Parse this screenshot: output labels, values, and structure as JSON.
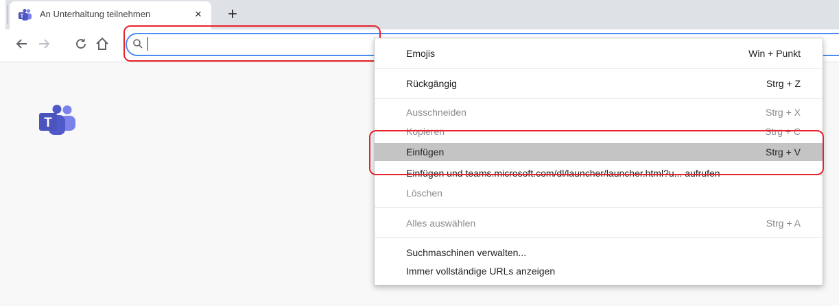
{
  "tab": {
    "title": "An Unterhaltung teilnehmen",
    "close": "×",
    "new_tab": "+"
  },
  "icons": {
    "tab_favicon": "teams-icon",
    "back": "back-arrow-icon",
    "forward": "forward-arrow-icon",
    "reload": "reload-icon",
    "home": "home-icon",
    "search": "search-icon",
    "page_logo": "teams-logo-icon"
  },
  "omnibox": {
    "value": "",
    "placeholder": ""
  },
  "context_menu": {
    "items": [
      {
        "label": "Emojis",
        "shortcut": "Win + Punkt",
        "state": "enabled"
      },
      {
        "label": "Rückgängig",
        "shortcut": "Strg + Z",
        "state": "enabled"
      },
      {
        "label": "Ausschneiden",
        "shortcut": "Strg + X",
        "state": "disabled"
      },
      {
        "label": "Kopieren",
        "shortcut": "Strg + C",
        "state": "disabled"
      },
      {
        "label": "Einfügen",
        "shortcut": "Strg + V",
        "state": "highlighted"
      },
      {
        "label": "Einfügen und teams.microsoft.com/dl/launcher/launcher.html?u... aufrufen",
        "shortcut": "",
        "state": "enabled"
      },
      {
        "label": "Löschen",
        "shortcut": "",
        "state": "disabled"
      },
      {
        "label": "Alles auswählen",
        "shortcut": "Strg + A",
        "state": "disabled"
      },
      {
        "label": "Suchmaschinen verwalten...",
        "shortcut": "",
        "state": "enabled"
      },
      {
        "label": "Immer vollständige URLs anzeigen",
        "shortcut": "",
        "state": "enabled"
      }
    ]
  },
  "colors": {
    "annotation": "#e8212a",
    "highlight": "#c4c4c4",
    "teams_brand": "#5059c9",
    "omnibox_focus": "#4c8bf5"
  }
}
